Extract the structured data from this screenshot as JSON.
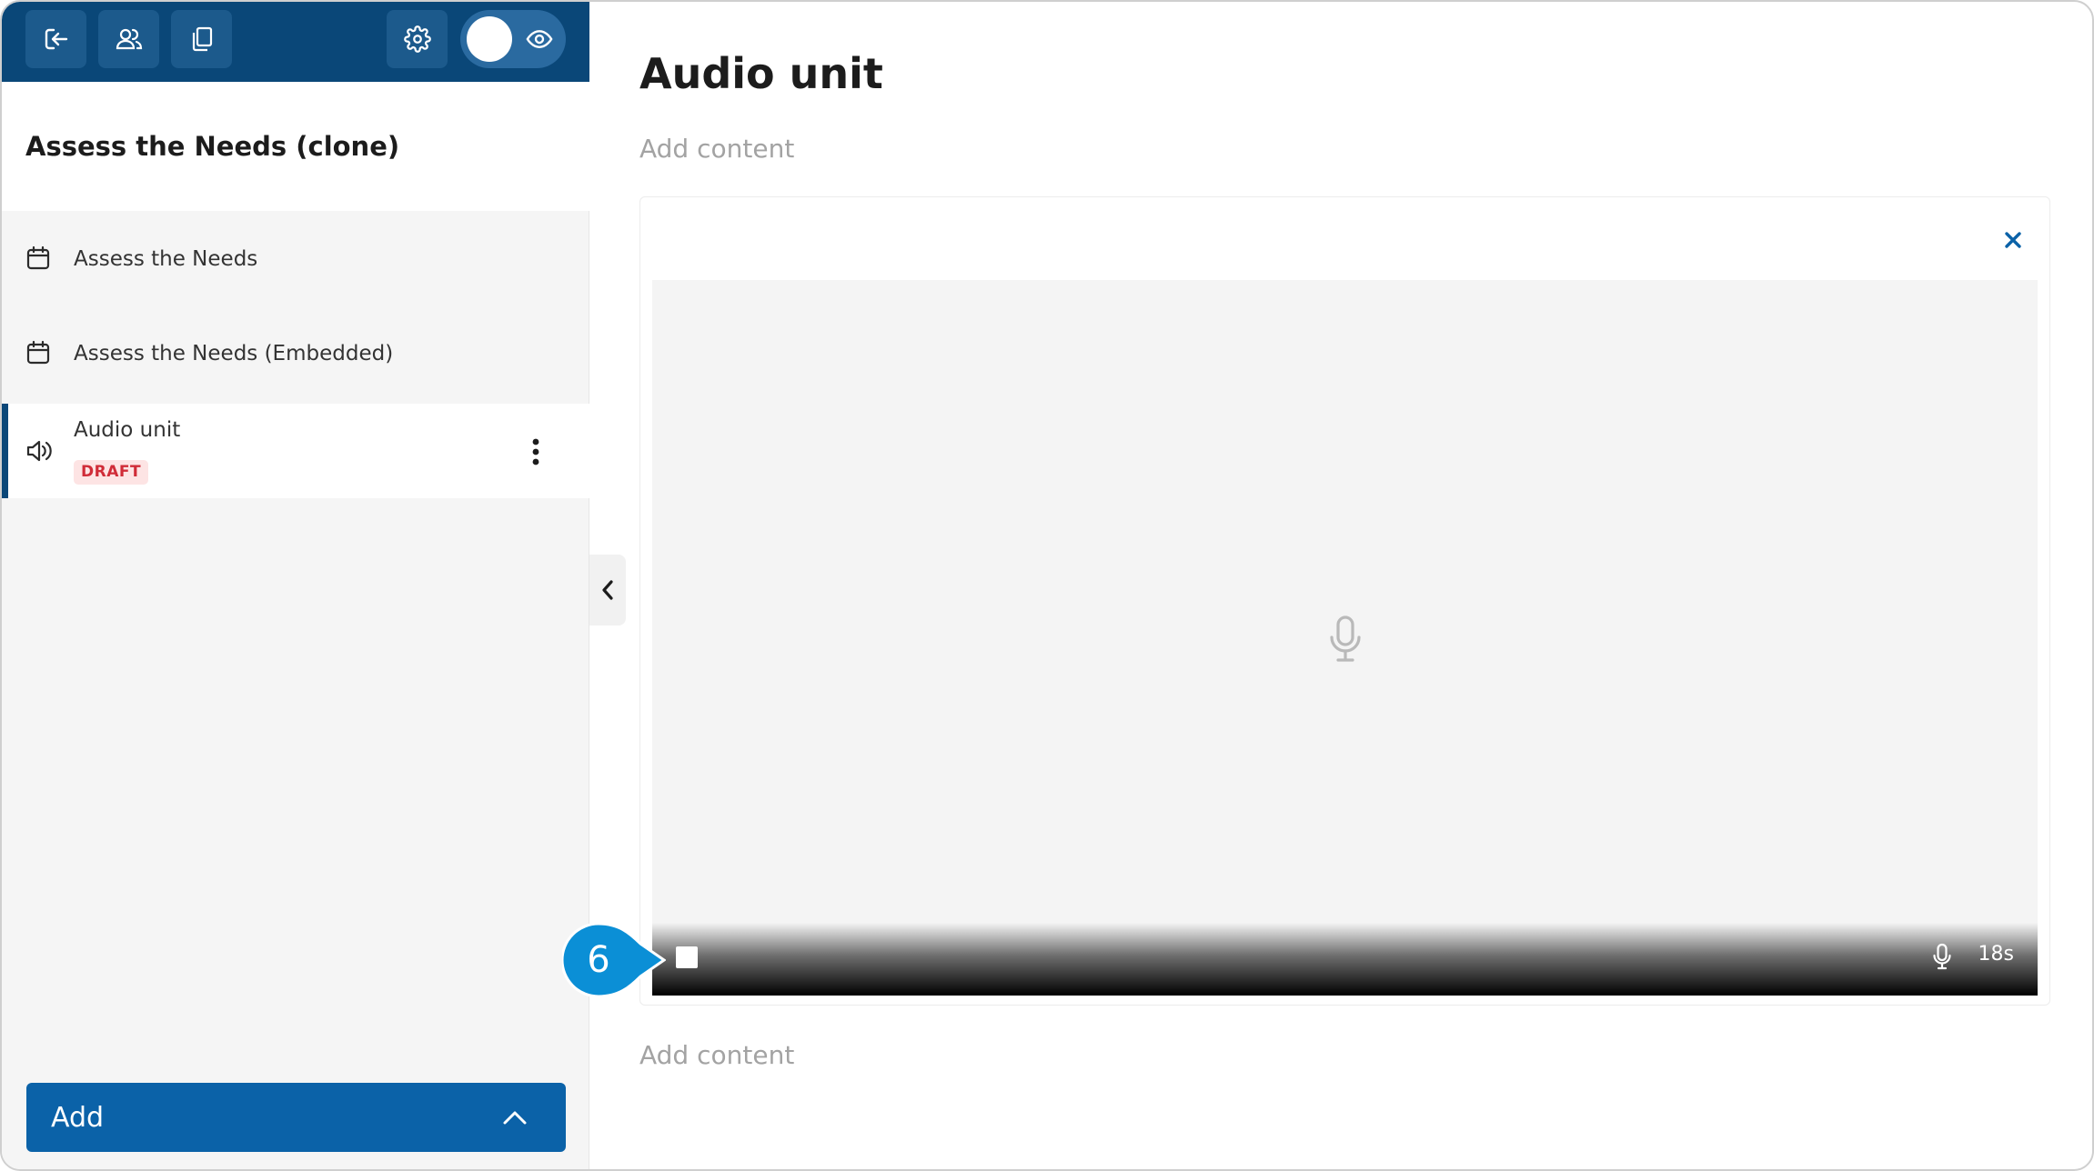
{
  "sidebar": {
    "course_title": "Assess the Needs (clone)",
    "items": [
      {
        "label": "Assess the Needs",
        "icon": "calendar-icon"
      },
      {
        "label": "Assess the Needs (Embedded)",
        "icon": "calendar-icon"
      },
      {
        "label": "Audio unit",
        "icon": "speaker-icon",
        "badge": "DRAFT",
        "active": true
      }
    ],
    "add_button_label": "Add"
  },
  "main": {
    "page_title": "Audio unit",
    "add_content_top": "Add content",
    "add_content_bottom": "Add content",
    "recorder": {
      "timer": "18s"
    }
  },
  "callout": {
    "number": "6"
  },
  "colors": {
    "brand_dark": "#0a4778",
    "brand_button": "#0b62a8",
    "badge_text": "#d02c38",
    "badge_bg": "#fde4e4",
    "callout": "#0b8fd6"
  }
}
